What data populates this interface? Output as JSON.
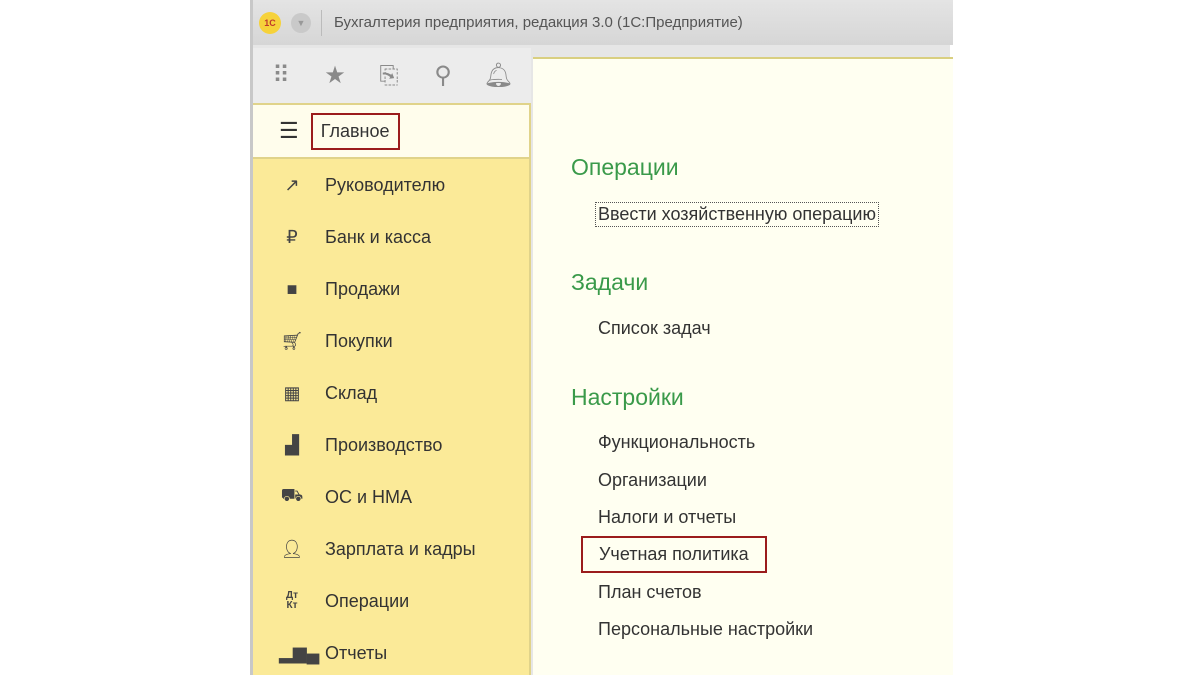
{
  "window": {
    "title": "Бухгалтерия предприятия, редакция 3.0  (1С:Предприятие)",
    "logo": "1С"
  },
  "toolbar": {
    "icons": [
      "apps-grid-icon",
      "star-icon",
      "history-icon",
      "search-icon",
      "bell-icon"
    ]
  },
  "sidebar": {
    "main": "Главное",
    "items": [
      {
        "label": "Руководителю",
        "icon": "trend-icon"
      },
      {
        "label": "Банк и касса",
        "icon": "ruble-icon"
      },
      {
        "label": "Продажи",
        "icon": "shopping-bag-icon"
      },
      {
        "label": "Покупки",
        "icon": "cart-icon"
      },
      {
        "label": "Склад",
        "icon": "warehouse-icon"
      },
      {
        "label": "Производство",
        "icon": "factory-icon"
      },
      {
        "label": "ОС и НМА",
        "icon": "truck-icon"
      },
      {
        "label": "Зарплата и кадры",
        "icon": "person-icon"
      },
      {
        "label": "Операции",
        "icon": "dt-kt-icon"
      },
      {
        "label": "Отчеты",
        "icon": "bar-chart-icon"
      }
    ]
  },
  "content": {
    "operations": {
      "title": "Операции",
      "links": [
        "Ввести хозяйственную операцию"
      ]
    },
    "tasks": {
      "title": "Задачи",
      "links": [
        "Список задач"
      ]
    },
    "settings": {
      "title": "Настройки",
      "links": [
        "Функциональность",
        "Организации",
        "Налоги и отчеты",
        "Учетная политика",
        "План счетов",
        "Персональные настройки"
      ]
    }
  }
}
